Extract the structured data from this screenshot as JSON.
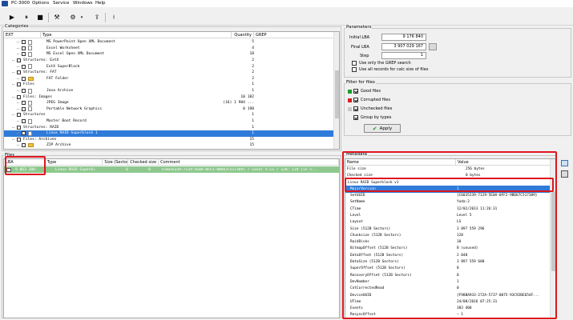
{
  "app": {
    "title": "PC-3000"
  },
  "menu": [
    "Options",
    "Service",
    "Windows",
    "Help"
  ],
  "toolbar": {
    "icons": [
      "play-icon",
      "pause-icon",
      "stop-icon",
      "tools-icon",
      "settings-icon",
      "export-icon",
      "cursor-icon"
    ]
  },
  "categories": {
    "title": "Categories",
    "columns": [
      "EXT",
      "Type",
      "Quantity",
      "GREP"
    ],
    "rows": [
      {
        "type": "MS PowerPoint Open XML Document",
        "qty": "5",
        "indent": 3,
        "icon": "file"
      },
      {
        "type": "Excel Worksheet",
        "qty": "4",
        "indent": 3,
        "icon": "file"
      },
      {
        "type": "MS Excel Open XML Document",
        "qty": "18",
        "indent": 3,
        "icon": "file"
      },
      {
        "type": "Structures: ExtX",
        "qty": "2",
        "indent": 1,
        "icon": "none"
      },
      {
        "type": "ExtX SuperBlock",
        "qty": "2",
        "indent": 3,
        "icon": "file"
      },
      {
        "type": "Structures: FAT",
        "qty": "2",
        "indent": 1,
        "icon": "none"
      },
      {
        "type": "FAT Folder",
        "qty": "2",
        "indent": 3,
        "icon": "folder"
      },
      {
        "type": "Files",
        "qty": "1",
        "indent": 1,
        "icon": "none"
      },
      {
        "type": "Java Archive",
        "qty": "1",
        "indent": 3,
        "icon": "file"
      },
      {
        "type": "Files: Images",
        "qty": "10 182",
        "indent": 1,
        "icon": "none"
      },
      {
        "type": "JPEG Image",
        "qty": "(16) 1 984 ...",
        "indent": 3,
        "icon": "file"
      },
      {
        "type": "Portable Network Graphics",
        "qty": "8 198",
        "indent": 3,
        "icon": "file"
      },
      {
        "type": "Structures",
        "qty": "1",
        "indent": 1,
        "icon": "none"
      },
      {
        "type": "Master Boot Record",
        "qty": "1",
        "indent": 3,
        "icon": "file"
      },
      {
        "type": "Structures: RAID",
        "qty": "1",
        "indent": 1,
        "icon": "none"
      },
      {
        "type": "Linux RAID Superblock 1",
        "qty": "1",
        "indent": 3,
        "icon": "file",
        "selected": true
      },
      {
        "type": "Files: Archives",
        "qty": "15",
        "indent": 1,
        "icon": "none"
      },
      {
        "type": "ZIP Archive",
        "qty": "15",
        "indent": 3,
        "icon": "folder"
      }
    ]
  },
  "parameters": {
    "title": "Parameters",
    "initial_lba_label": "Initial LBA",
    "initial_lba": "9 176 840",
    "final_lba_label": "Final LBA",
    "final_lba": "3 907 029 167",
    "step_label": "Step",
    "step": "1",
    "grep_label": "Use only the GREP search",
    "calc_label": "Use all records for calc size of files"
  },
  "filter": {
    "title": "Filter for files",
    "good": "Good files",
    "corrupted": "Corrupted files",
    "unchecked": "Unchecked files",
    "group": "Group by types",
    "apply": "Apply",
    "colors": {
      "good": "#1a9e2a",
      "corrupted": "#d42020",
      "unchecked": "#c8c8c8"
    }
  },
  "files": {
    "title": "Files",
    "columns": [
      "LBA",
      "Type",
      "Size (Sectors)",
      "Checked size (S...",
      "Comment"
    ],
    "rows": [
      {
        "lba": "9 863 208",
        "type": "Linux RAID Superbl",
        "size": "0",
        "checked": "0",
        "comment": "(C6035239-7129-5E0A-0FF2-9BD67C517389) / Level 5-LS / 128: 129 (in 5..."
      }
    ]
  },
  "metadata": {
    "title": "Metadata",
    "columns": [
      "Name",
      "Value"
    ],
    "file_size_label": "File size",
    "file_size": "256 bytes",
    "checked_size_label": "Checked size",
    "checked_size": "0 bytes",
    "group": "Linux RAID Superblock v1",
    "fields": [
      {
        "name": "MajorVersion",
        "value": "1",
        "selected": true
      },
      {
        "name": "SetUUID",
        "value": "{C6035239-7129-5E0A-0FF2-9BD67C517389}"
      },
      {
        "name": "SetName",
        "value": "Yoda:2"
      },
      {
        "name": "CTime",
        "value": "12/02/2013 11:26:31"
      },
      {
        "name": "Level",
        "value": "Level 5"
      },
      {
        "name": "Layout",
        "value": "LS"
      },
      {
        "name": "Size (512B Sectors)",
        "value": "3 897 559 296"
      },
      {
        "name": "Chunksize (512B Sectors)",
        "value": "128"
      },
      {
        "name": "RaidDisks",
        "value": "10"
      },
      {
        "name": "BitmapOffset (512B Sectors)",
        "value": "8 (unused)"
      },
      {
        "name": "DataOffset (512B Sectors)",
        "value": "2 048"
      },
      {
        "name": "DataSize (512B Sectors)",
        "value": "3 897 559 680"
      },
      {
        "name": "SuperOffset (512B Sectors)",
        "value": "8"
      },
      {
        "name": "RecoveryOffset (512B Sectors)",
        "value": "0"
      },
      {
        "name": "DevNumber",
        "value": "1"
      },
      {
        "name": "CntCorrectedRead",
        "value": "0"
      },
      {
        "name": "DeviceUUID",
        "value": "{F98BA933-272A-5737-0075-93C92BE654F..."
      },
      {
        "name": "UTime",
        "value": "24/08/2016 07:25:31"
      },
      {
        "name": "Events",
        "value": "383 400"
      },
      {
        "name": "ResyncOffset",
        "value": "— 1"
      }
    ]
  }
}
